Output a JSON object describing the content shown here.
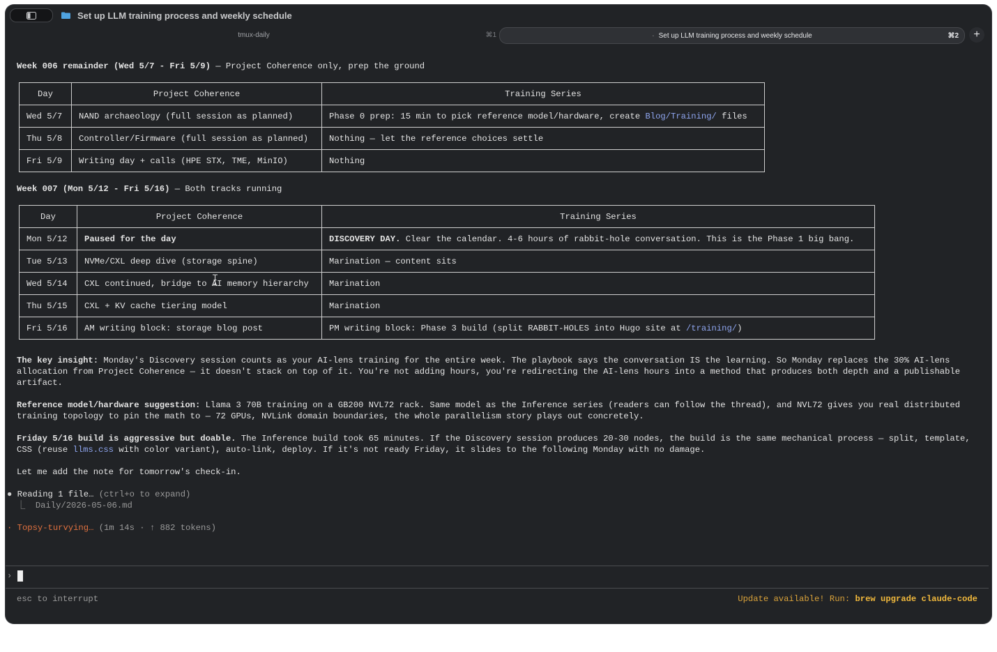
{
  "window": {
    "title": "Set up LLM training process and weekly schedule"
  },
  "tabs": [
    {
      "label": "tmux-daily",
      "shortcut": "⌘1"
    },
    {
      "label": "Set up LLM training process and weekly schedule",
      "shortcut": "⌘2"
    }
  ],
  "new_tab_label": "+",
  "week006": {
    "heading_bold": "Week 006 remainder (Wed 5/7 - Fri 5/9)",
    "heading_rest": " — Project Coherence only, prep the ground",
    "columns": [
      "Day",
      "Project Coherence",
      "Training Series"
    ],
    "rows": [
      {
        "day": "Wed 5/7",
        "coherence": "NAND archaeology (full session as planned)",
        "training_pre": "Phase 0 prep: 15 min to pick reference model/hardware, create ",
        "training_link": "Blog/Training/",
        "training_post": " files"
      },
      {
        "day": "Thu 5/8",
        "coherence": "Controller/Firmware (full session as planned)",
        "training": "Nothing — let the reference choices settle"
      },
      {
        "day": "Fri 5/9",
        "coherence": "Writing day + calls (HPE STX, TME, MinIO)",
        "training": "Nothing"
      }
    ]
  },
  "week007": {
    "heading_bold": "Week 007 (Mon 5/12 - Fri 5/16)",
    "heading_rest": " — Both tracks running",
    "columns": [
      "Day",
      "Project Coherence",
      "Training Series"
    ],
    "rows": [
      {
        "day": "Mon 5/12",
        "coherence": "Paused for the day",
        "training_bold": "DISCOVERY DAY.",
        "training_rest": " Clear the calendar. 4-6 hours of rabbit-hole conversation. This is the Phase 1 big bang."
      },
      {
        "day": "Tue 5/13",
        "coherence": "NVMe/CXL deep dive (storage spine)",
        "training": "Marination — content sits"
      },
      {
        "day": "Wed 5/14",
        "coherence": "CXL continued, bridge to AI memory hierarchy",
        "training": "Marination"
      },
      {
        "day": "Thu 5/15",
        "coherence": "CXL + KV cache tiering model",
        "training": "Marination"
      },
      {
        "day": "Fri 5/16",
        "coherence": "AM writing block: storage blog post",
        "training_pre": "PM writing block: Phase 3 build (split RABBIT-HOLES into Hugo site at ",
        "training_link": "/training/",
        "training_post": ")"
      }
    ]
  },
  "insight": {
    "bold": "The key insight:",
    "text": " Monday's Discovery session counts as your AI-lens training for the entire week. The playbook says the conversation IS the learning. So Monday replaces the 30% AI-lens allocation from Project Coherence — it doesn't stack on top of it. You're not adding hours, you're redirecting the AI-lens hours into a method that produces both depth and a publishable artifact."
  },
  "reference": {
    "bold": "Reference model/hardware suggestion:",
    "text": " Llama 3 70B training on a GB200 NVL72 rack. Same model as the Inference series (readers can follow the thread), and NVL72 gives you real distributed training topology to pin the math to — 72 GPUs, NVLink domain boundaries, the whole parallelism story plays out concretely."
  },
  "friday": {
    "bold": "Friday 5/16 build is aggressive but doable.",
    "text_pre": " The Inference build took 65 minutes. If the Discovery session produces 20-30 nodes, the build is the same mechanical process — split, template, CSS (reuse ",
    "link": "llms.css",
    "text_post": " with color variant), auto-link, deploy. If it's not ready Friday, it slides to the following Monday with no damage."
  },
  "closing": "Let me add the note for tomorrow's check-in.",
  "tool": {
    "bullet": "●",
    "label": "Reading 1 file…",
    "hint": " (ctrl+o to expand)",
    "branch": "⎿",
    "file": "Daily/2026-05-06.md"
  },
  "status": {
    "dot": "·",
    "label": "Topsy-turvying…",
    "detail": " (1m 14s · ↑ 882 tokens)"
  },
  "prompt_symbol": "›",
  "footer": {
    "left": "esc to interrupt",
    "right_pre": "Update available! Run: ",
    "right_cmd": "brew upgrade claude-code"
  }
}
